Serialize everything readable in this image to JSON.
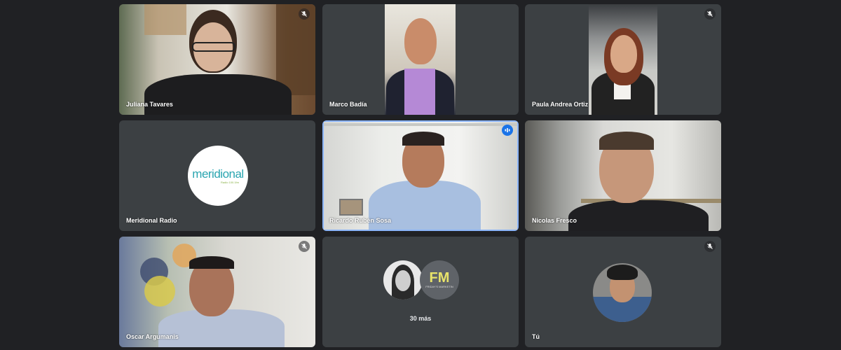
{
  "participants": [
    {
      "name": "Juliana Tavares",
      "muted": true
    },
    {
      "name": "Marco Badía",
      "muted": false
    },
    {
      "name": "Paula Andrea Ortiz",
      "muted": true
    },
    {
      "name": "Meridional Radio",
      "muted": false,
      "logo": {
        "text": "meridional",
        "sub": "Radio 100.1fm"
      }
    },
    {
      "name": "Ricardo Rubén Sosa",
      "muted": false,
      "speaking": true
    },
    {
      "name": "Nicolas Fresco",
      "muted": false
    },
    {
      "name": "Oscar Argumanis",
      "muted": true
    },
    {
      "name": "",
      "muted": false,
      "overflow_label": "30 más",
      "fm_logo": "FM",
      "fm_sub": "FRIDAY'S MARKETIN"
    },
    {
      "name": "Tú",
      "muted": true
    }
  ],
  "icons": {
    "mute": "mic-off-icon",
    "speaking": "audio-level-icon"
  },
  "colors": {
    "background": "#202124",
    "tile": "#3c4043",
    "speaking_border": "#8ab4f8",
    "speaking_badge": "#1a73e8",
    "logo_teal": "#2aa5b0",
    "logo_green": "#8bb34a"
  }
}
